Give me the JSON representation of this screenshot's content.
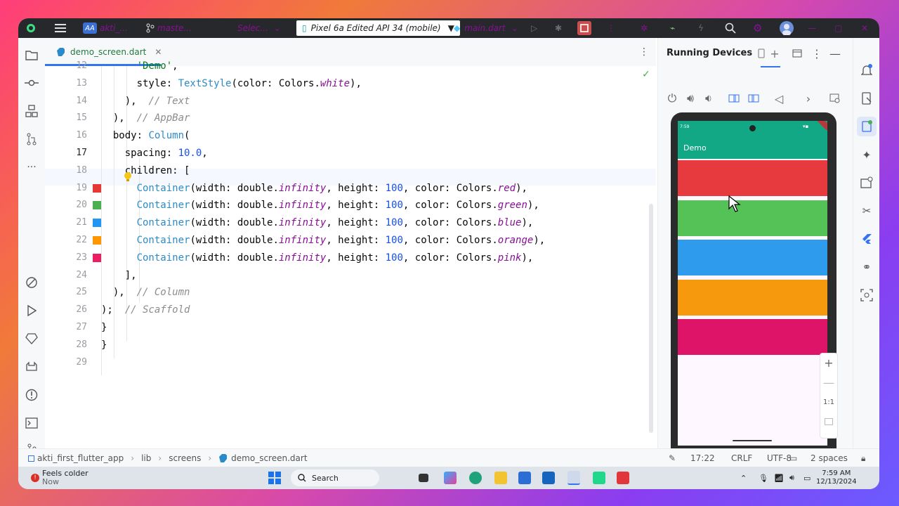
{
  "titlebar": {
    "project_badge": "AA",
    "project": "akti_...",
    "branch": "maste...",
    "select": "Selec...",
    "device": "Pixel 6a Edited API 34 (mobile)",
    "run_config": "main.dart"
  },
  "editor": {
    "tab": "demo_screen.dart",
    "lines": [
      {
        "n": "12",
        "tokens": [
          {
            "t": "      "
          },
          {
            "t": "'Demo'",
            "c": "str"
          },
          {
            "t": ","
          }
        ]
      },
      {
        "n": "13",
        "tokens": [
          {
            "t": "      style: "
          },
          {
            "t": "TextStyle",
            "c": "cls"
          },
          {
            "t": "(color: Colors."
          },
          {
            "t": "white",
            "c": "it"
          },
          {
            "t": "),"
          }
        ]
      },
      {
        "n": "14",
        "tokens": [
          {
            "t": "    ),  "
          },
          {
            "t": "// Text",
            "c": "cm"
          }
        ]
      },
      {
        "n": "15",
        "tokens": [
          {
            "t": "  ),  "
          },
          {
            "t": "// AppBar",
            "c": "cm"
          }
        ]
      },
      {
        "n": "16",
        "tokens": [
          {
            "t": "  body: "
          },
          {
            "t": "Column",
            "c": "cls"
          },
          {
            "t": "("
          }
        ]
      },
      {
        "n": "17",
        "tokens": [
          {
            "t": "    spacing: "
          },
          {
            "t": "10.0",
            "c": "num"
          },
          {
            "t": ","
          }
        ]
      },
      {
        "n": "18",
        "tokens": [
          {
            "t": "    children: ["
          }
        ]
      },
      {
        "n": "19",
        "tokens": [
          {
            "t": "      "
          },
          {
            "t": "Container",
            "c": "cls"
          },
          {
            "t": "(width: double."
          },
          {
            "t": "infinity",
            "c": "it"
          },
          {
            "t": ", height: "
          },
          {
            "t": "100",
            "c": "num"
          },
          {
            "t": ", color: Colors."
          },
          {
            "t": "red",
            "c": "it"
          },
          {
            "t": "),"
          }
        ]
      },
      {
        "n": "20",
        "tokens": [
          {
            "t": "      "
          },
          {
            "t": "Container",
            "c": "cls"
          },
          {
            "t": "(width: double."
          },
          {
            "t": "infinity",
            "c": "it"
          },
          {
            "t": ", height: "
          },
          {
            "t": "100",
            "c": "num"
          },
          {
            "t": ", color: Colors."
          },
          {
            "t": "green",
            "c": "it"
          },
          {
            "t": "),"
          }
        ]
      },
      {
        "n": "21",
        "tokens": [
          {
            "t": "      "
          },
          {
            "t": "Container",
            "c": "cls"
          },
          {
            "t": "(width: double."
          },
          {
            "t": "infinity",
            "c": "it"
          },
          {
            "t": ", height: "
          },
          {
            "t": "100",
            "c": "num"
          },
          {
            "t": ", color: Colors."
          },
          {
            "t": "blue",
            "c": "it"
          },
          {
            "t": "),"
          }
        ]
      },
      {
        "n": "22",
        "tokens": [
          {
            "t": "      "
          },
          {
            "t": "Container",
            "c": "cls"
          },
          {
            "t": "(width: double."
          },
          {
            "t": "infinity",
            "c": "it"
          },
          {
            "t": ", height: "
          },
          {
            "t": "100",
            "c": "num"
          },
          {
            "t": ", color: Colors."
          },
          {
            "t": "orange",
            "c": "it"
          },
          {
            "t": "),"
          }
        ]
      },
      {
        "n": "23",
        "tokens": [
          {
            "t": "      "
          },
          {
            "t": "Container",
            "c": "cls"
          },
          {
            "t": "(width: double."
          },
          {
            "t": "infinity",
            "c": "it"
          },
          {
            "t": ", height: "
          },
          {
            "t": "100",
            "c": "num"
          },
          {
            "t": ", color: Colors."
          },
          {
            "t": "pink",
            "c": "it"
          },
          {
            "t": "),"
          }
        ]
      },
      {
        "n": "24",
        "tokens": [
          {
            "t": "    ],"
          }
        ]
      },
      {
        "n": "25",
        "tokens": [
          {
            "t": "  ),  "
          },
          {
            "t": "// Column",
            "c": "cm"
          }
        ]
      },
      {
        "n": "26",
        "tokens": [
          {
            "t": ");  "
          },
          {
            "t": "// Scaffold",
            "c": "cm"
          }
        ]
      },
      {
        "n": "27",
        "tokens": [
          {
            "t": "}"
          }
        ]
      },
      {
        "n": "28",
        "tokens": [
          {
            "t": "}"
          }
        ]
      },
      {
        "n": "29",
        "tokens": [
          {
            "t": ""
          }
        ]
      }
    ],
    "current_line": "17",
    "swatches": {
      "19": "#e53935",
      "20": "#4caf50",
      "21": "#2196f3",
      "22": "#ff9800",
      "23": "#e91e63"
    }
  },
  "running_devices": {
    "title": "Running Devices",
    "phone": {
      "time": "7:59",
      "appbar_title": "Demo",
      "appbar_color": "#12a886",
      "bars": [
        "#e63a3f",
        "#55c257",
        "#2f9bec",
        "#f6990c",
        "#de1469"
      ]
    },
    "zoom_reset": "1:1"
  },
  "status": {
    "breadcrumb": [
      "akti_first_flutter_app",
      "lib",
      "screens",
      "demo_screen.dart"
    ],
    "position": "17:22",
    "line_sep": "CRLF",
    "encoding": "UTF-8",
    "indent": "2 spaces"
  },
  "taskbar": {
    "weather": "Feels colder",
    "weather_sub": "Now",
    "search": "Search",
    "time": "7:59 AM",
    "date": "12/13/2024"
  }
}
